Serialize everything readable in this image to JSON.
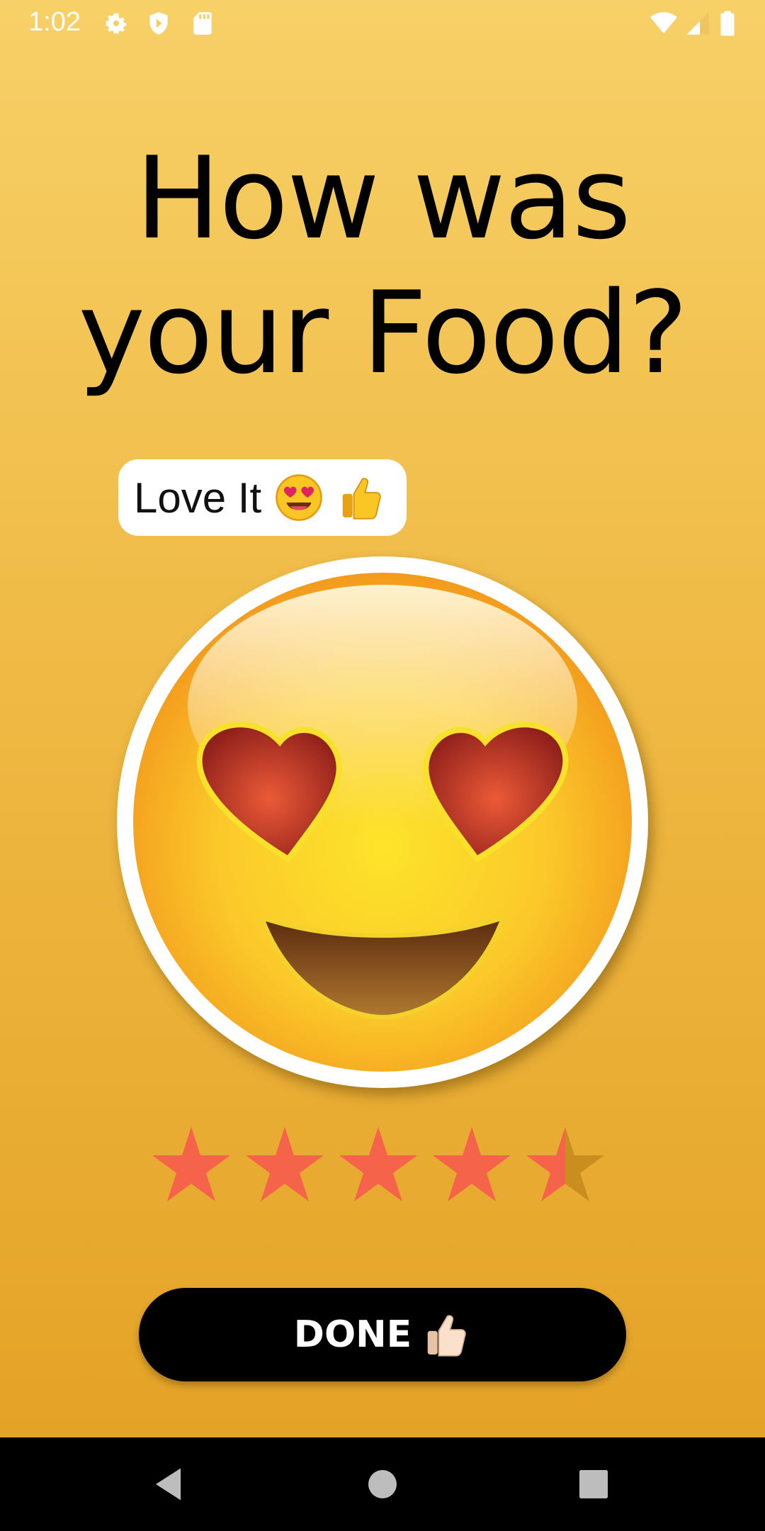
{
  "status_bar": {
    "time": "1:02",
    "left_icons": [
      "gear-icon",
      "shield-icon",
      "sd-card-icon"
    ],
    "right_icons": [
      "wifi-icon",
      "signal-icon",
      "battery-icon"
    ]
  },
  "title": {
    "line1": "How was",
    "line2": "your Food?"
  },
  "mood_chip": {
    "label": "Love It",
    "emojis": [
      "heart-eyes-emoji-icon",
      "thumbs-up-icon"
    ]
  },
  "face": {
    "icon": "heart-eyes-face-icon"
  },
  "rating": {
    "value": 4.5,
    "max": 5,
    "filled_color": "#f5634a",
    "empty_color": "#c98e1f"
  },
  "done_button": {
    "label": "DONE",
    "icon": "thumbs-up-icon"
  },
  "nav_bar": {
    "buttons": [
      "back-icon",
      "home-icon",
      "recents-icon"
    ]
  },
  "colors": {
    "background_top": "#f7d067",
    "background_bottom": "#e3a023",
    "button": "#000000"
  }
}
